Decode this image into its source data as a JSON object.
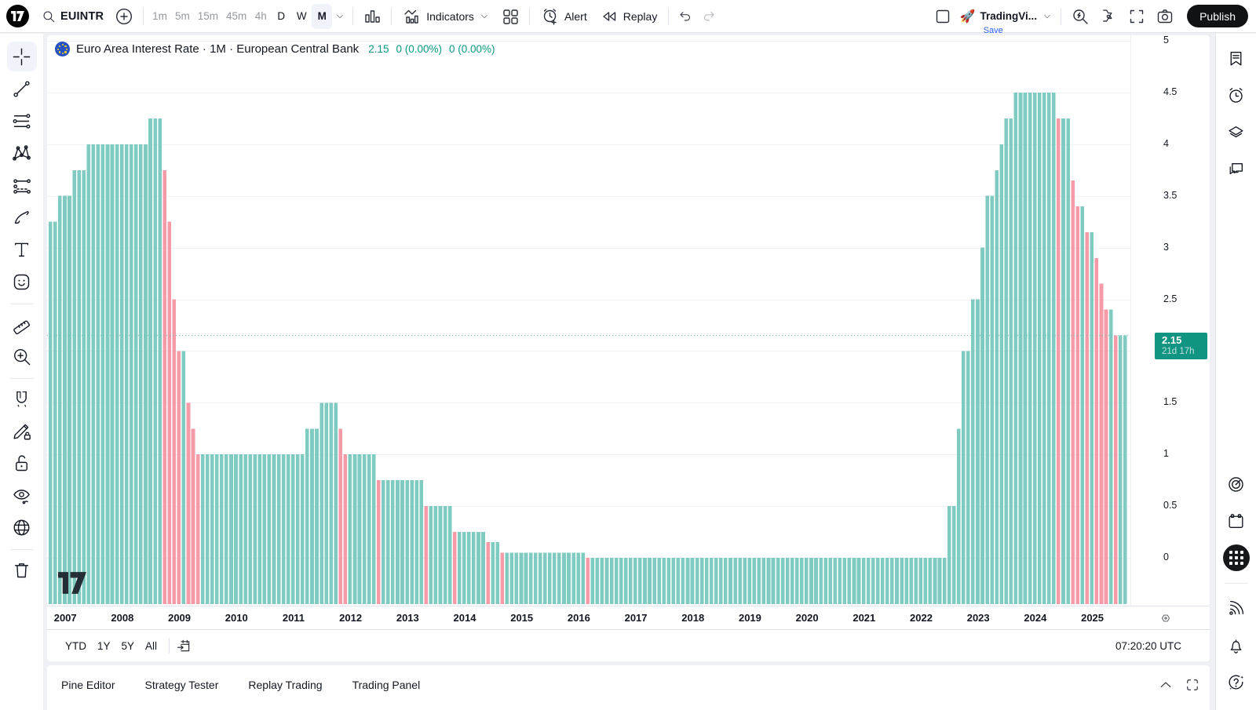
{
  "header": {
    "symbol": "EUINTR",
    "intervals": [
      {
        "label": "1m",
        "muted": true,
        "selected": false
      },
      {
        "label": "5m",
        "muted": true,
        "selected": false
      },
      {
        "label": "15m",
        "muted": true,
        "selected": false
      },
      {
        "label": "45m",
        "muted": true,
        "selected": false
      },
      {
        "label": "4h",
        "muted": true,
        "selected": false
      },
      {
        "label": "D",
        "muted": false,
        "selected": false
      },
      {
        "label": "W",
        "muted": false,
        "selected": false
      },
      {
        "label": "M",
        "muted": false,
        "selected": true
      }
    ],
    "indicators_label": "Indicators",
    "alert_label": "Alert",
    "replay_label": "Replay",
    "account_name": "TradingVi...",
    "save_label": "Save",
    "publish_label": "Publish"
  },
  "chart": {
    "title": "Euro Area Interest Rate · 1M · European Central Bank",
    "last_value": "2.15",
    "change_abs": "0 (0.00%)",
    "change_pct": "0 (0.00%)",
    "price_label": {
      "price": "2.15",
      "countdown": "21d 17h"
    },
    "time_label": "07:20:20 UTC",
    "range_buttons": [
      "YTD",
      "1Y",
      "5Y",
      "All"
    ]
  },
  "chart_data": {
    "type": "bar",
    "title": "Euro Area Interest Rate (EUINTR) · 1M · European Central Bank",
    "frequency": "monthly",
    "x_start": {
      "year": 2006,
      "month": 10
    },
    "values": [
      3.25,
      3.25,
      3.5,
      3.5,
      3.5,
      3.75,
      3.75,
      3.75,
      4,
      4,
      4,
      4,
      4,
      4,
      4,
      4,
      4,
      4,
      4,
      4,
      4,
      4.25,
      4.25,
      4.25,
      3.75,
      3.25,
      2.5,
      2,
      2,
      1.5,
      1.25,
      1,
      1,
      1,
      1,
      1,
      1,
      1,
      1,
      1,
      1,
      1,
      1,
      1,
      1,
      1,
      1,
      1,
      1,
      1,
      1,
      1,
      1,
      1,
      1.25,
      1.25,
      1.25,
      1.5,
      1.5,
      1.5,
      1.5,
      1.25,
      1,
      1,
      1,
      1,
      1,
      1,
      1,
      0.75,
      0.75,
      0.75,
      0.75,
      0.75,
      0.75,
      0.75,
      0.75,
      0.75,
      0.75,
      0.5,
      0.5,
      0.5,
      0.5,
      0.5,
      0.5,
      0.25,
      0.25,
      0.25,
      0.25,
      0.25,
      0.25,
      0.25,
      0.15,
      0.15,
      0.15,
      0.05,
      0.05,
      0.05,
      0.05,
      0.05,
      0.05,
      0.05,
      0.05,
      0.05,
      0.05,
      0.05,
      0.05,
      0.05,
      0.05,
      0.05,
      0.05,
      0.05,
      0.05,
      0,
      0,
      0,
      0,
      0,
      0,
      0,
      0,
      0,
      0,
      0,
      0,
      0,
      0,
      0,
      0,
      0,
      0,
      0,
      0,
      0,
      0,
      0,
      0,
      0,
      0,
      0,
      0,
      0,
      0,
      0,
      0,
      0,
      0,
      0,
      0,
      0,
      0,
      0,
      0,
      0,
      0,
      0,
      0,
      0,
      0,
      0,
      0,
      0,
      0,
      0,
      0,
      0,
      0,
      0,
      0,
      0,
      0,
      0,
      0,
      0,
      0,
      0,
      0,
      0,
      0,
      0,
      0,
      0,
      0,
      0,
      0,
      0,
      0,
      0,
      0,
      0.5,
      0.5,
      1.25,
      2,
      2,
      2.5,
      2.5,
      3,
      3.5,
      3.5,
      3.75,
      4,
      4.25,
      4.25,
      4.5,
      4.5,
      4.5,
      4.5,
      4.5,
      4.5,
      4.5,
      4.5,
      4.5,
      4.25,
      4.25,
      4.25,
      3.65,
      3.4,
      3.4,
      3.15,
      3.15,
      2.9,
      2.65,
      2.4,
      2.4,
      2.15,
      2.15,
      2.15
    ],
    "x_tick_years": [
      2007,
      2008,
      2009,
      2010,
      2011,
      2012,
      2013,
      2014,
      2015,
      2016,
      2017,
      2018,
      2019,
      2020,
      2021,
      2022,
      2023,
      2024,
      2025
    ],
    "y_ticks": [
      0,
      0.5,
      1,
      1.5,
      2,
      2.5,
      3,
      3.5,
      4,
      4.5,
      5
    ],
    "ylim": [
      -0.45,
      5.05
    ],
    "last_price": 2.15,
    "up_color": "#7fcbc2",
    "down_color": "#f59aa7",
    "last_price_line_color": "#66c1b6",
    "price_label_color": "#129482",
    "grid": true,
    "legend_position": "none"
  },
  "bottom_bar": {
    "items": [
      "Pine Editor",
      "Strategy Tester",
      "Replay Trading",
      "Trading Panel"
    ]
  }
}
